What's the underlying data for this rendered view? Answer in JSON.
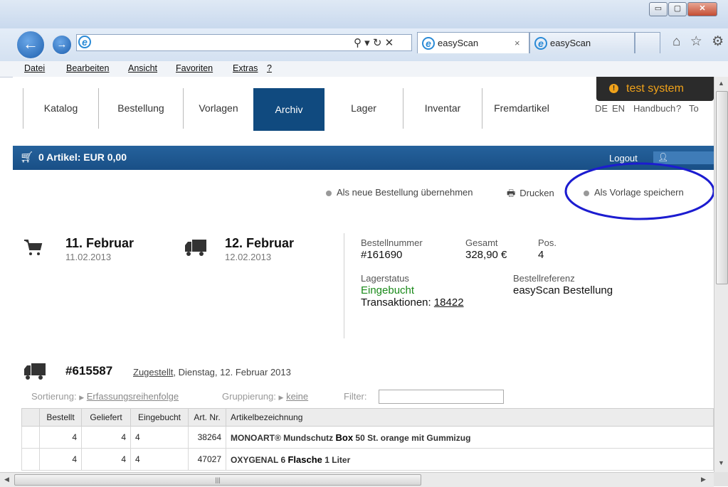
{
  "browser": {
    "tabs": [
      {
        "label": "easyScan"
      },
      {
        "label": "easyScan"
      }
    ],
    "address_value": "",
    "address_tools": "⚲ ▾ ↻ ✕",
    "tab_close": "×",
    "window_buttons": {
      "minimize": "▭",
      "maximize": "▢",
      "close": "✕"
    },
    "right_icons": "⌂ ☆ ⚙"
  },
  "menu": [
    {
      "label": "Datei"
    },
    {
      "label": "Bearbeiten"
    },
    {
      "label": "Ansicht"
    },
    {
      "label": "Favoriten"
    },
    {
      "label": "Extras"
    },
    {
      "label": "?"
    }
  ],
  "nav": {
    "items": [
      "Katalog",
      "Bestellung",
      "Vorlagen",
      "Archiv",
      "Lager",
      "Inventar",
      "Fremdartikel"
    ],
    "active": "Archiv",
    "lang_de": "DE",
    "lang_en": "EN",
    "handbuch": "Handbuch",
    "help": "?",
    "more": "To"
  },
  "test_badge": {
    "icon": "!",
    "label": "test system"
  },
  "cart": {
    "summary": "0 Artikel: EUR 0,00",
    "logout": "Logout"
  },
  "actions": {
    "new_order": "Als neue Bestellung übernehmen",
    "print": "Drucken",
    "save_template": "Als Vorlage speichern"
  },
  "order": {
    "order_date_title": "11. Februar",
    "order_date_sub": "11.02.2013",
    "delivery_date_title": "12. Februar",
    "delivery_date_sub": "12.02.2013",
    "labels": {
      "number": "Bestellnummer",
      "total": "Gesamt",
      "positions": "Pos.",
      "stock_status": "Lagerstatus",
      "reference": "Bestellreferenz"
    },
    "number": "#161690",
    "total": "328,90 €",
    "positions": "4",
    "stock_status": "Eingebucht",
    "transactions_label": "Transaktionen:",
    "transactions_value": "18422",
    "reference": "easyScan Bestellung"
  },
  "shipment": {
    "id": "#615587",
    "status": "Zugestellt",
    "date": ", Dienstag, 12. Februar 2013",
    "sort_label": "Sortierung:",
    "sort_value": "Erfassungsreihenfolge",
    "group_label": "Gruppierung:",
    "group_value": "keine",
    "filter_label": "Filter:",
    "filter_value": ""
  },
  "table": {
    "headers": [
      "Bestellt",
      "Geliefert",
      "Eingebucht",
      "Art. Nr.",
      "Artikelbezeichnung"
    ],
    "rows": [
      {
        "bestellt": "4",
        "geliefert": "4",
        "eingebucht": "4",
        "artnr": "38264",
        "bez_a": "MONOART® Mundschutz ",
        "bez_b": "Box",
        "bez_c": " 50 St. orange mit Gummizug"
      },
      {
        "bestellt": "4",
        "geliefert": "4",
        "eingebucht": "4",
        "artnr": "47027",
        "bez_a": "OXYGENAL 6 ",
        "bez_b": "Flasche",
        "bez_c": " 1 Liter"
      }
    ]
  },
  "colors": {
    "accent": "#104a7f",
    "cartbar": "#1d5a93",
    "status_green": "#1a8a1a",
    "annotation": "#1c1cd0",
    "badge_bg": "#2b2b2b",
    "badge_icon": "#f0a21a"
  }
}
